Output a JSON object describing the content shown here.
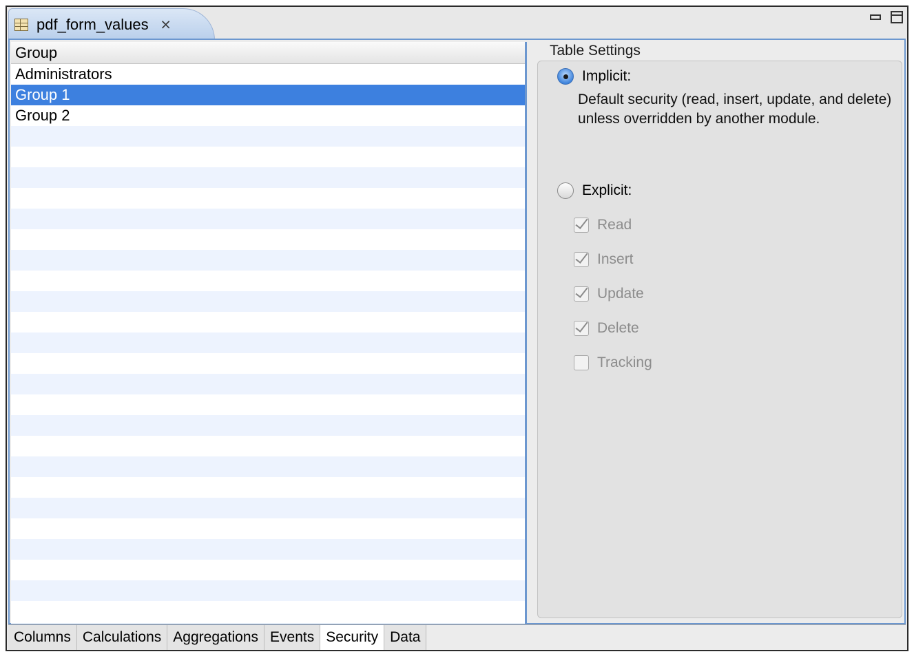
{
  "editor_tab": {
    "title": "pdf_form_values",
    "icon": "table-icon",
    "close_icon": "close-icon"
  },
  "window_controls": {
    "minimize_icon": "minimize-icon",
    "maximize_icon": "maximize-icon"
  },
  "table": {
    "column_header": "Group",
    "rows": [
      "Administrators",
      "Group 1",
      "Group 2"
    ],
    "selected_row": "Group 1"
  },
  "settings": {
    "section_label": "Table Settings",
    "implicit": {
      "label": "Implicit:",
      "selected": true,
      "description": "Default security (read, insert, update, and delete) unless overridden by another module."
    },
    "explicit": {
      "label": "Explicit:",
      "selected": false,
      "options": [
        {
          "label": "Read",
          "checked": true
        },
        {
          "label": "Insert",
          "checked": true
        },
        {
          "label": "Update",
          "checked": true
        },
        {
          "label": "Delete",
          "checked": true
        },
        {
          "label": "Tracking",
          "checked": false
        }
      ]
    }
  },
  "bottom_tabs": {
    "items": [
      "Columns",
      "Calculations",
      "Aggregations",
      "Events",
      "Security",
      "Data"
    ],
    "active": "Security"
  },
  "colors": {
    "selection": "#3d80df",
    "alt_row": "#edf3fe",
    "panel_border": "#6c97cf",
    "disabled_text": "#8c8c8c"
  }
}
